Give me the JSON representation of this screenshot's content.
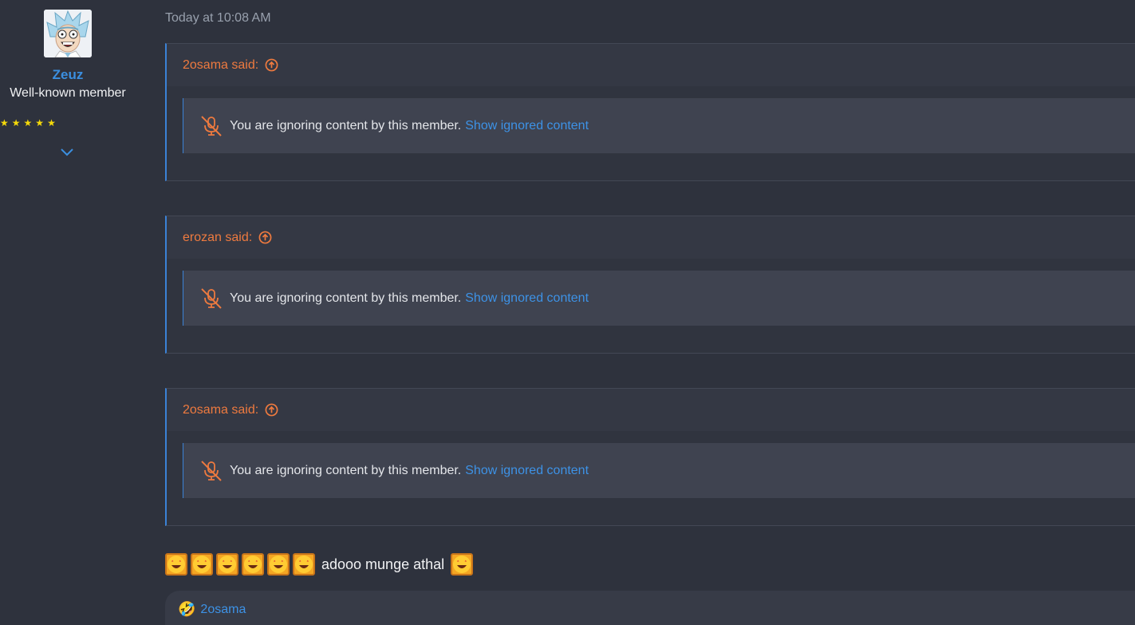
{
  "user": {
    "name": "Zeuz",
    "title": "Well-known member",
    "avatar_icon": "rick-avatar",
    "rating_stars": 5,
    "expand_icon": "chevron-down-icon"
  },
  "post": {
    "timestamp": "Today at 10:08 AM",
    "quotes": [
      {
        "author_said": "2osama said:",
        "ignored_text": "You are ignoring content by this member.",
        "show_link": "Show ignored content"
      },
      {
        "author_said": "erozan said:",
        "ignored_text": "You are ignoring content by this member.",
        "show_link": "Show ignored content"
      },
      {
        "author_said": "2osama said:",
        "ignored_text": "You are ignoring content by this member.",
        "show_link": "Show ignored content"
      }
    ],
    "message_text": "adooo munge athal",
    "reaction_emoji": "🤣",
    "reaction_user": "2osama"
  },
  "colors": {
    "accent_blue": "#3b8fe0",
    "quote_orange": "#ee7a3f",
    "star_yellow": "#f5d90a",
    "background": "#2e323d"
  }
}
